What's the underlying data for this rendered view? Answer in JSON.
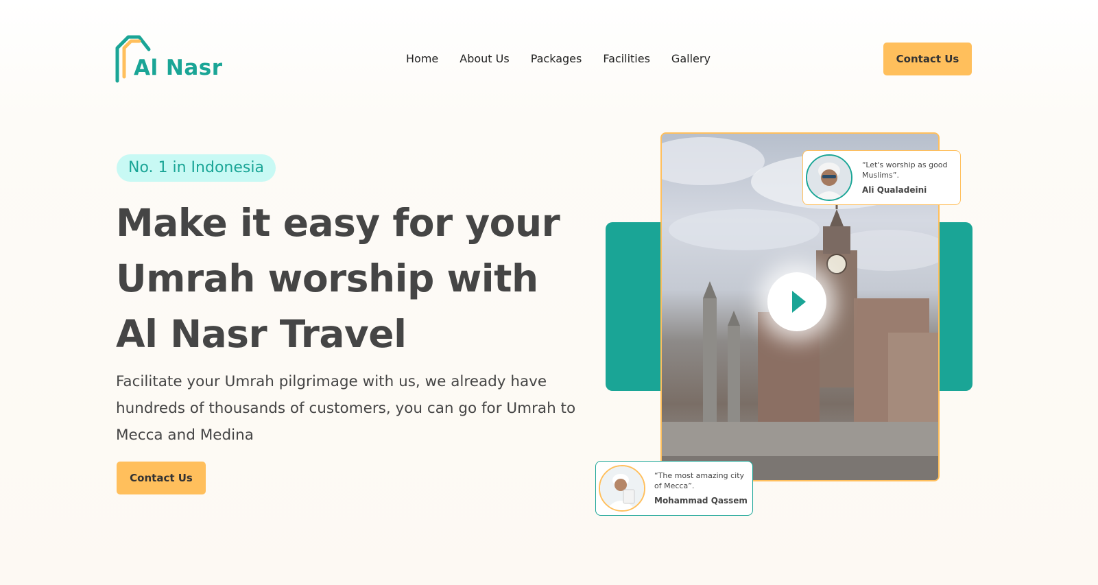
{
  "brand": {
    "name": "Al Nasr",
    "colors": {
      "teal": "#1aa596",
      "accent": "#ffbf5c",
      "text": "#454545",
      "badge_bg": "#c8f9f4"
    },
    "logo_icon": "house-arch-icon"
  },
  "nav": {
    "items": [
      {
        "label": "Home"
      },
      {
        "label": "About Us"
      },
      {
        "label": "Packages"
      },
      {
        "label": "Facilities"
      },
      {
        "label": "Gallery"
      }
    ],
    "cta_label": "Contact Us"
  },
  "hero": {
    "badge": "No. 1 in Indonesia",
    "title": "Make it easy for your Umrah worship with Al Nasr Travel",
    "description": "Facilitate your Umrah pilgrimage with us, we already have hundreds of thousands of customers, you can go for Umrah to Mecca and Medina",
    "cta_label": "Contact Us"
  },
  "media": {
    "video_icon": "play-icon",
    "testimonials": [
      {
        "quote": "“Let's worship as good Muslims”.",
        "author": "Ali Qualadeini"
      },
      {
        "quote": "“The most amazing city of Mecca”.",
        "author": "Mohammad Qassem"
      }
    ]
  }
}
